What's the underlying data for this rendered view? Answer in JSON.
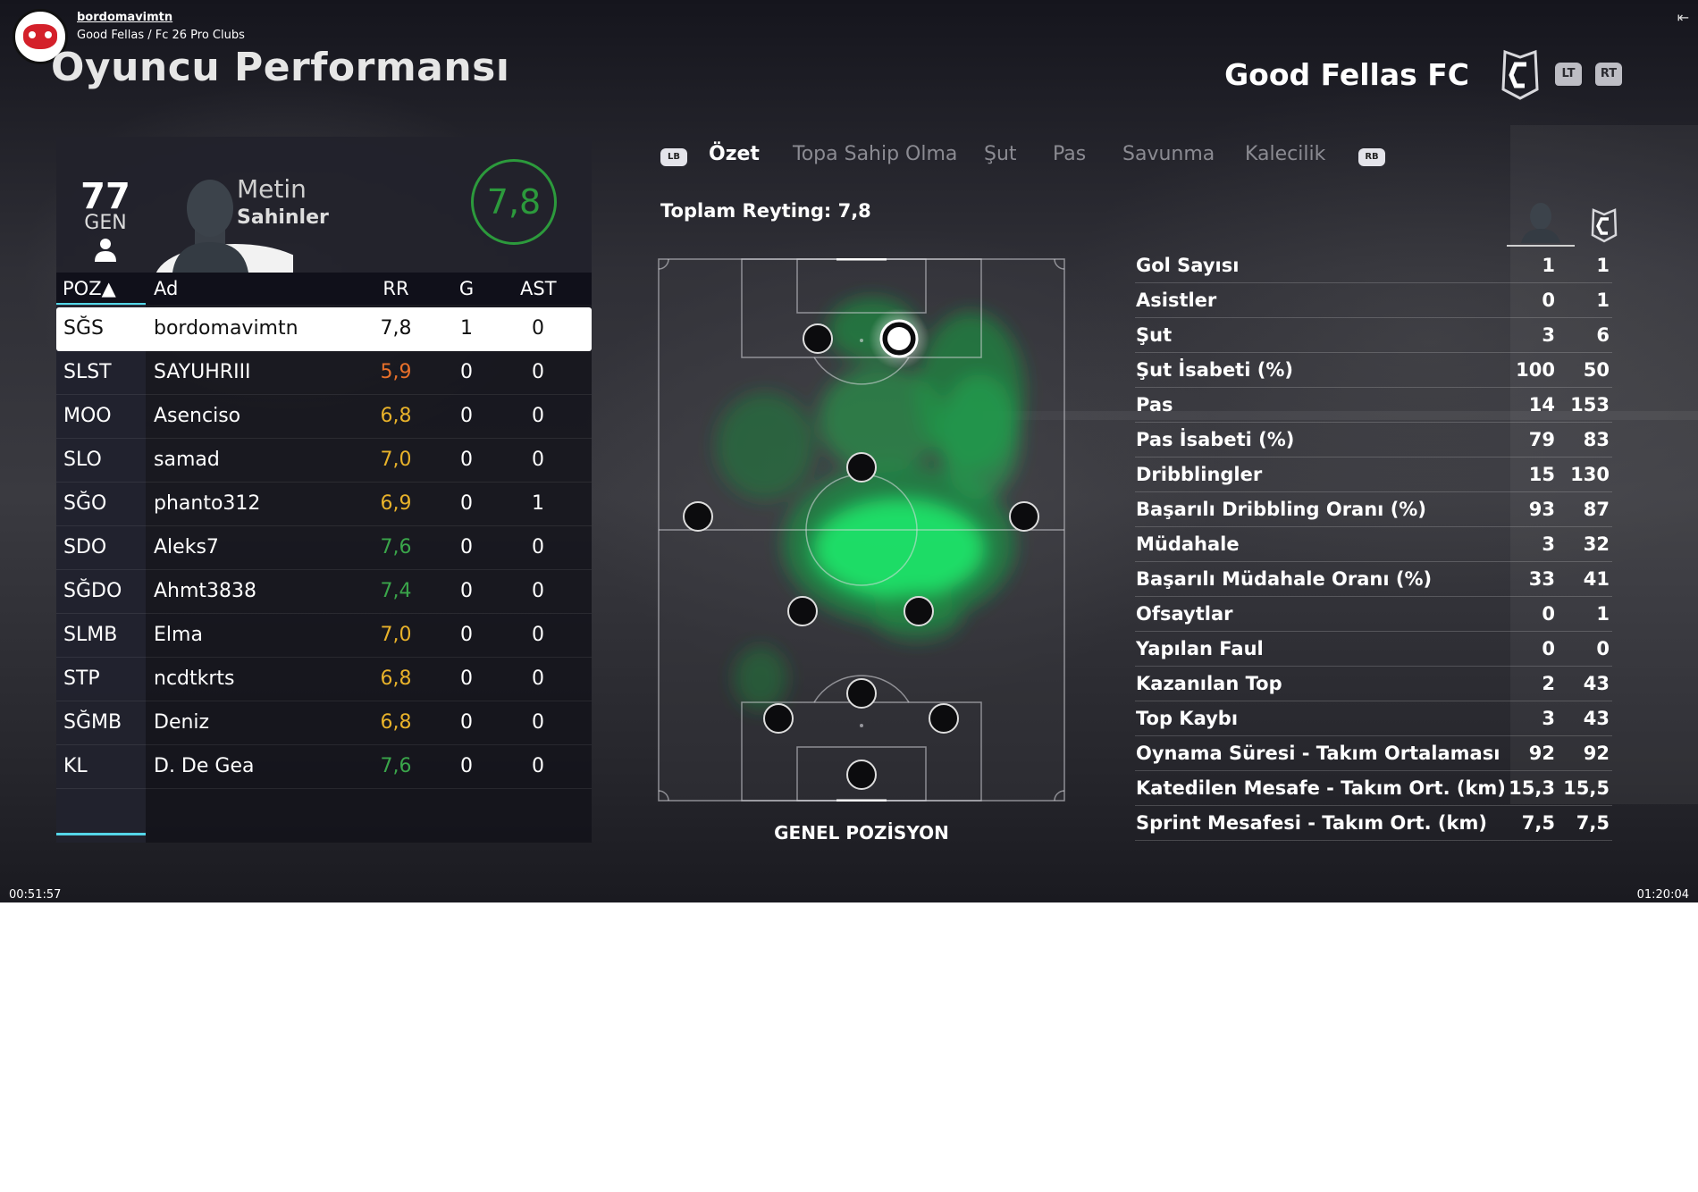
{
  "stream": {
    "username": "bordomavimtn",
    "subtitle": "Good Fellas / Fc 26 Pro Clubs",
    "time_elapsed": "00:51:57",
    "time_total": "01:20:04"
  },
  "page_title": "Oyuncu Performansı",
  "club": {
    "name": "Good Fellas FC",
    "btn_lt": "LT",
    "btn_rt": "RT"
  },
  "player": {
    "gen_value": "77",
    "gen_label": "GEN",
    "first_name": "Metin",
    "last_name": "Sahinler",
    "rating": "7,8"
  },
  "table": {
    "headers": {
      "poz": "POZ▲",
      "ad": "Ad",
      "rr": "RR",
      "g": "G",
      "ast": "AST"
    },
    "rows": [
      {
        "poz": "SĞS",
        "ad": "bordomavimtn",
        "rr": "7,8",
        "g": "1",
        "ast": "0",
        "rr_color": "#111111"
      },
      {
        "poz": "SLST",
        "ad": "SAYUHRIII",
        "rr": "5,9",
        "g": "0",
        "ast": "0",
        "rr_color": "#e8702a"
      },
      {
        "poz": "MOO",
        "ad": "Asenciso",
        "rr": "6,8",
        "g": "0",
        "ast": "0",
        "rr_color": "#e8b22a"
      },
      {
        "poz": "SLO",
        "ad": "samad",
        "rr": "7,0",
        "g": "0",
        "ast": "0",
        "rr_color": "#e8b22a"
      },
      {
        "poz": "SĞO",
        "ad": "phanto312",
        "rr": "6,9",
        "g": "0",
        "ast": "1",
        "rr_color": "#e8b22a"
      },
      {
        "poz": "SDO",
        "ad": "Aleks7",
        "rr": "7,6",
        "g": "0",
        "ast": "0",
        "rr_color": "#3aa54a"
      },
      {
        "poz": "SĞDO",
        "ad": "Ahmt3838",
        "rr": "7,4",
        "g": "0",
        "ast": "0",
        "rr_color": "#3aa54a"
      },
      {
        "poz": "SLMB",
        "ad": "Elma",
        "rr": "7,0",
        "g": "0",
        "ast": "0",
        "rr_color": "#e8b22a"
      },
      {
        "poz": "STP",
        "ad": "ncdtkrts",
        "rr": "6,8",
        "g": "0",
        "ast": "0",
        "rr_color": "#e8b22a"
      },
      {
        "poz": "SĞMB",
        "ad": "Deniz",
        "rr": "6,8",
        "g": "0",
        "ast": "0",
        "rr_color": "#e8b22a"
      },
      {
        "poz": "KL",
        "ad": "D. De Gea",
        "rr": "7,6",
        "g": "0",
        "ast": "0",
        "rr_color": "#3aa54a"
      }
    ]
  },
  "tabs": {
    "lb": "LB",
    "rb": "RB",
    "items": [
      "Özet",
      "Topa Sahip Olma",
      "Şut",
      "Pas",
      "Savunma",
      "Kalecilik"
    ],
    "active_index": 0
  },
  "total_rating": "Toplam Reyting: 7,8",
  "pitch_caption": "GENEL POZİSYON",
  "stats": [
    {
      "label": "Gol Sayısı",
      "player": "1",
      "team": "1"
    },
    {
      "label": "Asistler",
      "player": "0",
      "team": "1"
    },
    {
      "label": "Şut",
      "player": "3",
      "team": "6"
    },
    {
      "label": "Şut İsabeti (%)",
      "player": "100",
      "team": "50"
    },
    {
      "label": "Pas",
      "player": "14",
      "team": "153"
    },
    {
      "label": "Pas İsabeti (%)",
      "player": "79",
      "team": "83"
    },
    {
      "label": "Dribblingler",
      "player": "15",
      "team": "130"
    },
    {
      "label": "Başarılı Dribbling Oranı (%)",
      "player": "93",
      "team": "87"
    },
    {
      "label": "Müdahale",
      "player": "3",
      "team": "32"
    },
    {
      "label": "Başarılı Müdahale Oranı (%)",
      "player": "33",
      "team": "41"
    },
    {
      "label": "Ofsaytlar",
      "player": "0",
      "team": "1"
    },
    {
      "label": "Yapılan Faul",
      "player": "0",
      "team": "0"
    },
    {
      "label": "Kazanılan Top",
      "player": "2",
      "team": "43"
    },
    {
      "label": "Top Kaybı",
      "player": "3",
      "team": "43"
    },
    {
      "label": "Oynama Süresi - Takım Ortalaması",
      "player": "92",
      "team": "92"
    },
    {
      "label": "Katedilen Mesafe - Takım Ort. (km)",
      "player": "15,3",
      "team": "15,5"
    },
    {
      "label": "Sprint Mesafesi - Takım Ort. (km)",
      "player": "7,5",
      "team": "7,5"
    }
  ],
  "colors": {
    "accent_cyan": "#54d6e8",
    "rating_green": "#2c9a3c",
    "heat_green": "#19e86a"
  }
}
